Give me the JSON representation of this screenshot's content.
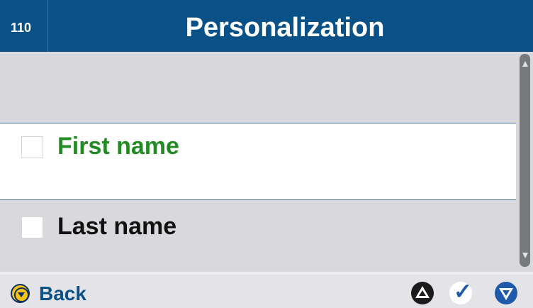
{
  "header": {
    "screen_number": "110",
    "title": "Personalization"
  },
  "list": {
    "items": [
      {
        "label": "First name",
        "checked": false,
        "label_color": "#228b22"
      },
      {
        "label": "Last name",
        "checked": false,
        "label_color": "#111111"
      }
    ]
  },
  "footer": {
    "back_label": "Back",
    "icons": {
      "back": "back-icon",
      "up": "up-arrow-icon",
      "confirm": "check-icon",
      "down": "down-arrow-icon"
    }
  },
  "colors": {
    "header": "#0a5188",
    "background": "#d9d8dc",
    "selected_row": "#ffffff",
    "accent": "#1f59a9",
    "highlight": "#228b22",
    "back_icon": "#f3c316"
  }
}
